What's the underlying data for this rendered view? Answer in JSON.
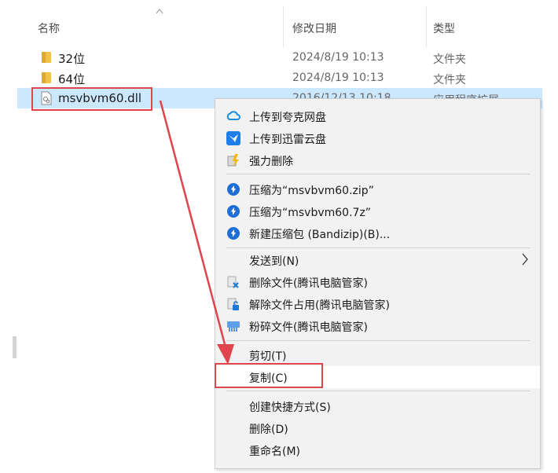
{
  "columns": {
    "name": "名称",
    "date": "修改日期",
    "type": "类型"
  },
  "files": [
    {
      "name": "32位",
      "date": "2024/8/19 10:13",
      "type": "文件夹"
    },
    {
      "name": "64位",
      "date": "2024/8/19 10:13",
      "type": "文件夹"
    },
    {
      "name": "msvbvm60.dll",
      "date": "2016/12/13 10:18",
      "type": "应用程序扩展"
    }
  ],
  "menu": {
    "upload_quark": "上传到夸克网盘",
    "upload_xunlei": "上传到迅雷云盘",
    "force_delete": "强力删除",
    "zip": "压缩为“msvbvm60.zip”",
    "sevenz": "压缩为“msvbvm60.7z”",
    "bandizip_new": "新建压缩包 (Bandizip)(B)...",
    "send_to": "发送到(N)",
    "tencent_delete": "删除文件(腾讯电脑管家)",
    "tencent_unlock": "解除文件占用(腾讯电脑管家)",
    "tencent_shred": "粉碎文件(腾讯电脑管家)",
    "cut": "剪切(T)",
    "copy": "复制(C)",
    "create_shortcut": "创建快捷方式(S)",
    "delete": "删除(D)",
    "rename": "重命名(M)"
  },
  "colors": {
    "highlight": "#e0444c",
    "selection": "#cce8ff",
    "menu_bg": "#f2f2f2"
  }
}
